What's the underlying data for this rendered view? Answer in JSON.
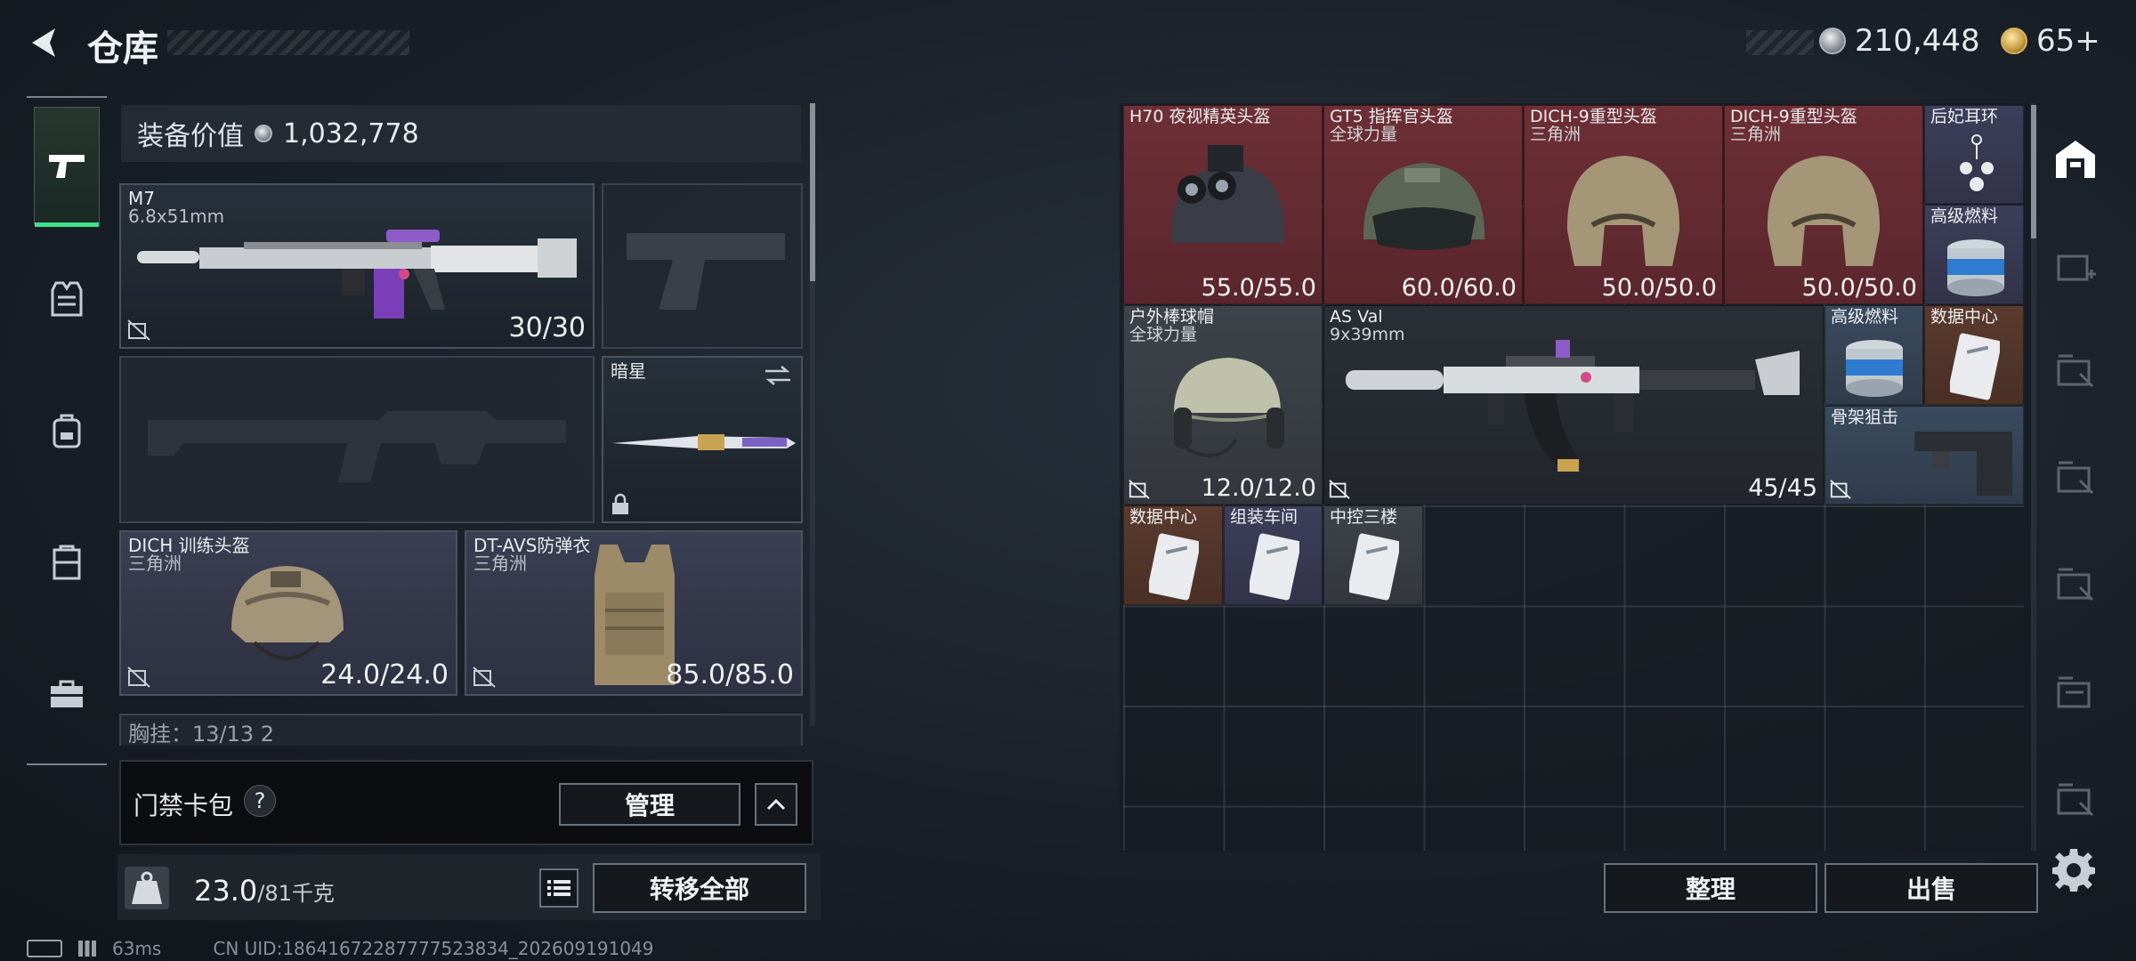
{
  "header": {
    "title": "仓库",
    "currency": {
      "silver_value": "210,448",
      "gold_value": "65+"
    }
  },
  "equipment": {
    "value_label": "装备价值",
    "value": "1,032,778",
    "primary_weapon": {
      "name": "M7",
      "caliber": "6.8x51mm",
      "ammo": "30/30"
    },
    "melee": {
      "name": "暗星"
    },
    "helmet": {
      "name": "DICH 训练头盔",
      "source": "三角洲",
      "durability": "24.0/24.0"
    },
    "armor": {
      "name": "DT-AVS防弹衣",
      "source": "三角洲",
      "durability": "85.0/85.0"
    },
    "chest_rig_partial": "胸挂：13/13   2"
  },
  "cards": {
    "label": "门禁卡包",
    "help": "?",
    "manage_label": "管理"
  },
  "capacity": {
    "current": "23.0",
    "max": "/81千克"
  },
  "buttons": {
    "transfer_all": "转移全部",
    "sort": "整理",
    "sell": "出售"
  },
  "status": {
    "ping": "63ms",
    "uid": "CN UID:1864167228777752383​4_202609191049"
  },
  "storage_items": [
    {
      "name": "H70 夜视精英头盔",
      "sub": "",
      "count": "55.0/55.0"
    },
    {
      "name": "GT5 指挥官头盔",
      "sub": "全球力量",
      "count": "60.0/60.0"
    },
    {
      "name": "DICH-9重型头盔",
      "sub": "三角洲",
      "count": "50.0/50.0"
    },
    {
      "name": "DICH-9重型头盔",
      "sub": "三角洲",
      "count": "50.0/50.0"
    },
    {
      "name": "后妃耳环",
      "sub": "",
      "count": ""
    },
    {
      "name": "高级燃料",
      "sub": "",
      "count": ""
    },
    {
      "name": "户外棒球帽",
      "sub": "全球力量",
      "count": "12.0/12.0"
    },
    {
      "name": "AS Val",
      "sub": "9x39mm",
      "count": "45/45"
    },
    {
      "name": "高级燃料",
      "sub": "",
      "count": ""
    },
    {
      "name": "数据中心",
      "sub": "",
      "count": ""
    },
    {
      "name": "骨架狙击",
      "sub": "",
      "count": ""
    },
    {
      "name": "数据中心",
      "sub": "",
      "count": ""
    },
    {
      "name": "组装车间",
      "sub": "",
      "count": ""
    },
    {
      "name": "中控三楼",
      "sub": "",
      "count": ""
    }
  ],
  "colors": {
    "accent_green": "#3ee08d",
    "rarity_red": "#6e2f36",
    "rarity_purple": "#3d3e5a",
    "rarity_grey": "#3e434a"
  }
}
